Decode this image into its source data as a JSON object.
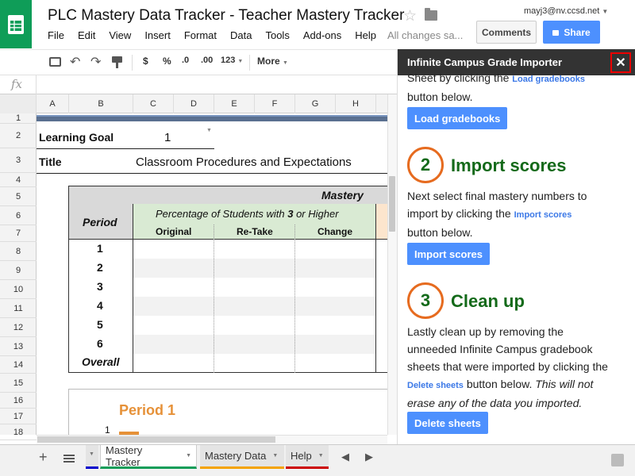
{
  "header": {
    "title": "PLC Mastery Data Tracker - Teacher Mastery Tracker",
    "user_email": "mayj3@nv.ccsd.net",
    "menu": [
      "File",
      "Edit",
      "View",
      "Insert",
      "Format",
      "Data",
      "Tools",
      "Add-ons",
      "Help"
    ],
    "save_status": "All changes sa...",
    "comments_label": "Comments",
    "share_label": "Share"
  },
  "toolbar": {
    "currency": "$",
    "percent": "%",
    "dec_less": ".0",
    "dec_more": ".00",
    "number_format": "123",
    "more_label": "More"
  },
  "columns": [
    "A",
    "B",
    "C",
    "D",
    "E",
    "F",
    "G",
    "H"
  ],
  "rows": [
    "1",
    "2",
    "3",
    "4",
    "5",
    "6",
    "7",
    "8",
    "9",
    "10",
    "11",
    "12",
    "13",
    "14",
    "15",
    "16",
    "17",
    "18"
  ],
  "sheet": {
    "learning_goal_label": "Learning Goal",
    "learning_goal_value": "1",
    "title_label": "Title",
    "title_value": "Classroom Procedures and Expectations",
    "mastery_label": "Mastery",
    "period_label": "Period",
    "pct_prefix": "Percentage of Students with ",
    "pct_num": "3",
    "pct_suffix": " or Higher",
    "col_original": "Original",
    "col_retake": "Re-Take",
    "col_change": "Change",
    "periods": [
      "1",
      "2",
      "3",
      "4",
      "5",
      "6",
      "Overall"
    ],
    "period1_heading": "Period 1",
    "period1_row": "1"
  },
  "sheet_tabs": [
    {
      "label": "Mastery Tracker",
      "color": "#0f9d58"
    },
    {
      "label": "Mastery Data",
      "color": "#f4a300"
    },
    {
      "label": "Help",
      "color": "#cc0000"
    }
  ],
  "sidebar": {
    "title": "Infinite Campus Grade Importer",
    "step1_text_a": "Sheet by clicking the",
    "step1_link": "Load gradebooks",
    "step1_text_b": "button below.",
    "load_button": "Load gradebooks",
    "step2_number": "2",
    "step2_title": "Import scores",
    "step2_text_a": "Next select final mastery numbers to",
    "step2_text_b": "import by clicking the",
    "step2_link": "Import scores",
    "step2_text_c": "button below.",
    "import_button": "Import scores",
    "step3_number": "3",
    "step3_title": "Clean up",
    "step3_text_a": "Lastly clean up by removing the",
    "step3_text_b": "unneeded Infinite Campus gradebook",
    "step3_text_c": "sheets that were imported by clicking the",
    "step3_link": "Delete sheets",
    "step3_text_d": "button below.",
    "step3_text_e": "This will not",
    "step3_text_f": "erase any of the data you imported.",
    "delete_button": "Delete sheets"
  },
  "colors": {
    "accent": "#4d90fe",
    "step_ring": "#e66b1f",
    "step_text": "#146a1a",
    "mastery_green": "#d9ead3"
  }
}
